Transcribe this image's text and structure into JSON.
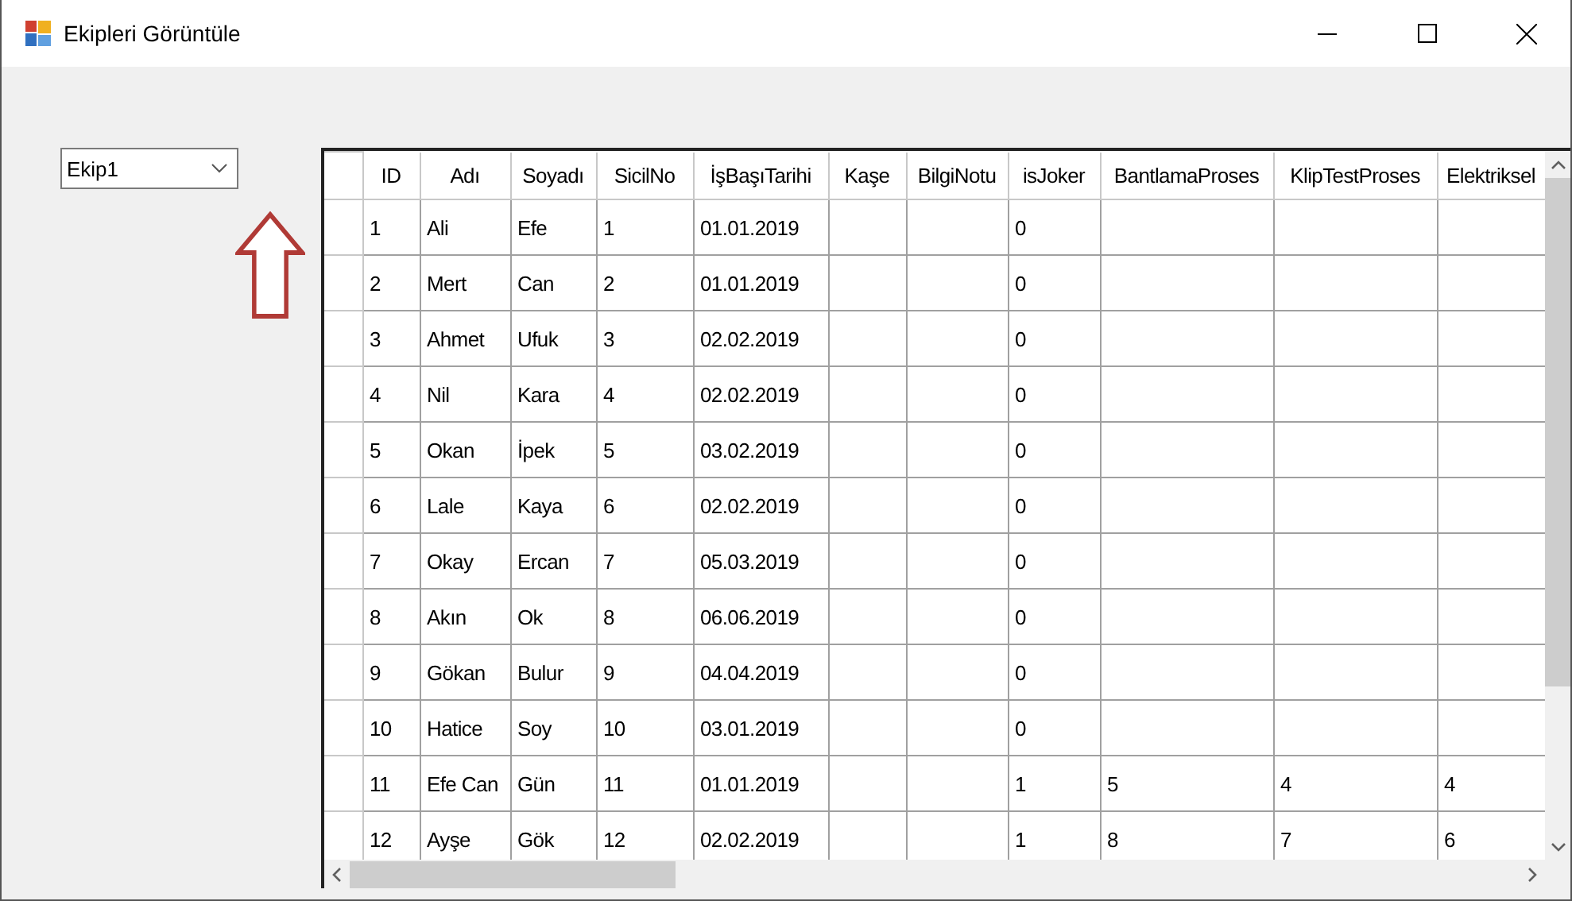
{
  "window": {
    "title": "Ekipleri Görüntüle"
  },
  "team_select": {
    "value": "Ekip1"
  },
  "grid": {
    "columns": [
      "ID",
      "Adı",
      "Soyadı",
      "SicilNo",
      "İşBaşıTarihi",
      "Kaşe",
      "BilgiNotu",
      "isJoker",
      "BantlamaProses",
      "KlipTestProses",
      "Elektriksel"
    ],
    "rows": [
      [
        "1",
        "Ali",
        "Efe",
        "1",
        "01.01.2019",
        null,
        null,
        "0",
        null,
        null,
        null
      ],
      [
        "2",
        "Mert",
        "Can",
        "2",
        "01.01.2019",
        null,
        null,
        "0",
        null,
        null,
        null
      ],
      [
        "3",
        "Ahmet",
        "Ufuk",
        "3",
        "02.02.2019",
        null,
        null,
        "0",
        null,
        null,
        null
      ],
      [
        "4",
        "Nil",
        "Kara",
        "4",
        "02.02.2019",
        null,
        null,
        "0",
        null,
        null,
        null
      ],
      [
        "5",
        "Okan",
        "İpek",
        "5",
        "03.02.2019",
        null,
        null,
        "0",
        null,
        null,
        null
      ],
      [
        "6",
        "Lale",
        "Kaya",
        "6",
        "02.02.2019",
        null,
        null,
        "0",
        null,
        null,
        null
      ],
      [
        "7",
        "Okay",
        "Ercan",
        "7",
        "05.03.2019",
        null,
        null,
        "0",
        null,
        null,
        null
      ],
      [
        "8",
        "Akın",
        "Ok",
        "8",
        "06.06.2019",
        null,
        null,
        "0",
        null,
        null,
        null
      ],
      [
        "9",
        "Gökan",
        "Bulur",
        "9",
        "04.04.2019",
        null,
        null,
        "0",
        null,
        null,
        null
      ],
      [
        "10",
        "Hatice",
        "Soy",
        "10",
        "03.01.2019",
        null,
        null,
        "0",
        null,
        null,
        null
      ],
      [
        "11",
        "Efe Can",
        "Gün",
        "11",
        "01.01.2019",
        null,
        null,
        "1",
        "5",
        "4",
        "4"
      ],
      [
        "12",
        "Ayşe",
        "Gök",
        "12",
        "02.02.2019",
        null,
        null,
        "1",
        "8",
        "7",
        "6"
      ]
    ]
  }
}
